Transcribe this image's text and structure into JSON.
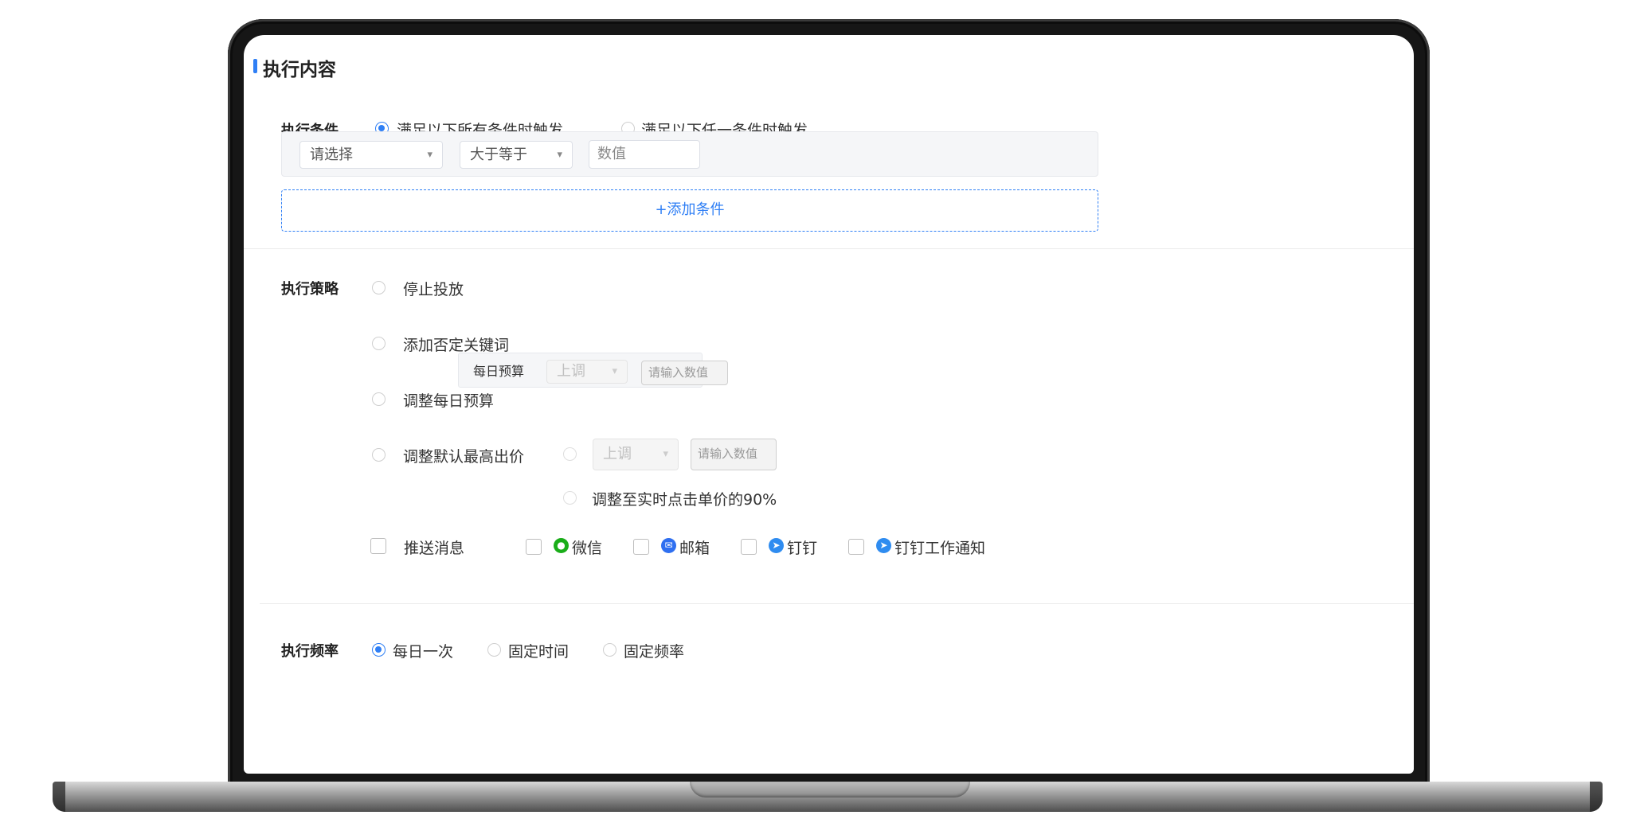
{
  "section": {
    "title": "执行内容"
  },
  "condition": {
    "label": "执行条件",
    "options": [
      "满足以下所有条件时触发",
      "满足以下任一条件时触发"
    ],
    "selected_index": 0,
    "row": {
      "field_select": {
        "value": "请选择"
      },
      "operator_select": {
        "value": "大于等于"
      },
      "value_input": {
        "placeholder": "数值"
      }
    },
    "add_button": "+添加条件"
  },
  "strategy": {
    "label": "执行策略",
    "options": [
      {
        "label": "停止投放"
      },
      {
        "label": "添加否定关键词"
      },
      {
        "label": "调整每日预算",
        "sub_label": "每日预算",
        "direction": "上调",
        "input_placeholder": "请输入数值"
      },
      {
        "label": "调整默认最高出价",
        "direction": "上调",
        "input_placeholder": "请输入数值",
        "alt_option": "调整至实时点击单价的90%"
      }
    ],
    "push": {
      "label": "推送消息",
      "channels": [
        "微信",
        "邮箱",
        "钉钉",
        "钉钉工作通知"
      ]
    }
  },
  "frequency": {
    "label": "执行频率",
    "options": [
      "每日一次",
      "固定时间",
      "固定频率"
    ],
    "selected_index": 0
  },
  "colors": {
    "accent": "#2f7ff5",
    "wechat": "#1aad19",
    "mail": "#2f6ff0",
    "dingtalk": "#2f8cf0"
  },
  "icons": {
    "wechat": "wechat-icon",
    "mail": "mail-icon",
    "dingtalk": "dingtalk-icon"
  }
}
